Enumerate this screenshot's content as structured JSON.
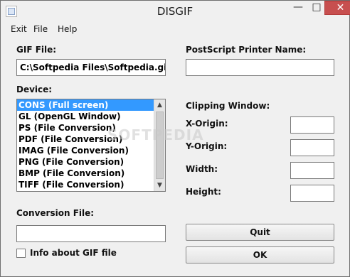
{
  "window": {
    "title": "DISGIF"
  },
  "menu": {
    "items": [
      "Exit",
      "File",
      "Help"
    ]
  },
  "gif": {
    "label": "GIF File:",
    "value": "C:\\Softpedia Files\\Softpedia.gif"
  },
  "printer": {
    "label": "PostScript Printer Name:",
    "value": ""
  },
  "device": {
    "label": "Device:",
    "items": [
      "CONS  (Full screen)",
      "GL    (OpenGL Window)",
      "PS    (File Conversion)",
      "PDF   (File Conversion)",
      "IMAG  (File Conversion)",
      "PNG   (File Conversion)",
      "BMP   (File Conversion)",
      "TIFF  (File Conversion)"
    ],
    "selected_index": 0
  },
  "clipping": {
    "label": "Clipping Window:",
    "x_origin_label": "X-Origin:",
    "y_origin_label": "Y-Origin:",
    "width_label": "Width:",
    "height_label": "Height:",
    "x_origin_value": "",
    "y_origin_value": "",
    "width_value": "",
    "height_value": ""
  },
  "conversion": {
    "label": "Conversion File:",
    "value": ""
  },
  "checkbox": {
    "label": "Info about GIF file",
    "checked": false
  },
  "buttons": {
    "quit": "Quit",
    "ok": "OK"
  },
  "watermark": {
    "text": "SOFTPEDIA"
  }
}
